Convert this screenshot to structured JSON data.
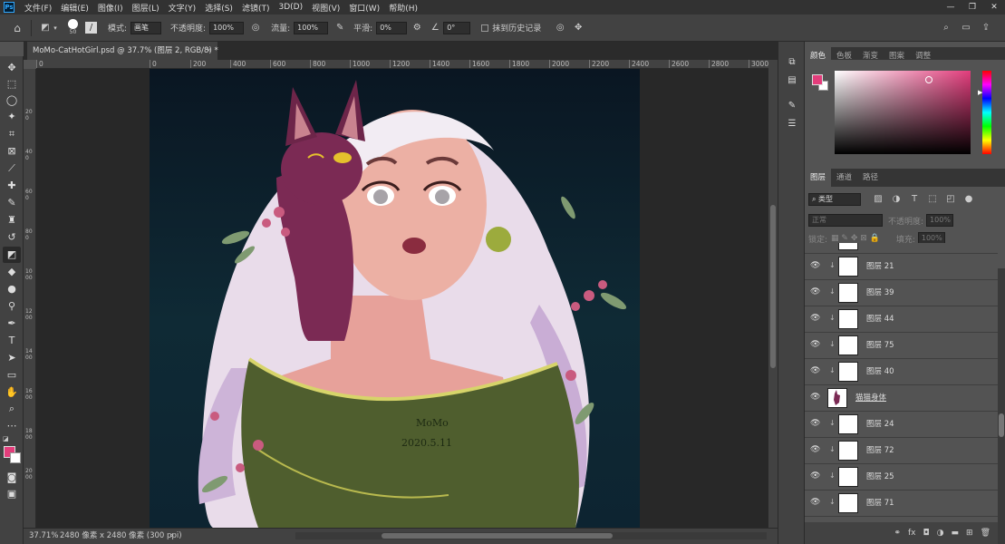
{
  "app": {
    "logo": "Ps"
  },
  "menu": [
    "文件(F)",
    "编辑(E)",
    "图像(I)",
    "图层(L)",
    "文字(Y)",
    "选择(S)",
    "滤镜(T)",
    "3D(D)",
    "视图(V)",
    "窗口(W)",
    "帮助(H)"
  ],
  "window_controls": [
    "—",
    "❐",
    "✕"
  ],
  "options": {
    "brush_size": "50",
    "mode_label": "模式:",
    "mode_value": "画笔",
    "opacity_label": "不透明度:",
    "opacity_value": "100%",
    "flow_label": "流量:",
    "flow_value": "100%",
    "smoothing_label": "平滑:",
    "smoothing_value": "0%",
    "angle_value": "0°",
    "erase_history_label": "抹到历史记录"
  },
  "document": {
    "tab_title": "MoMo-CatHotGirl.psd @ 37.7% (图层 2, RGB/8) *",
    "close": "×"
  },
  "ruler": {
    "h_ticks": [
      "0",
      "200",
      "400",
      "600",
      "800",
      "1000",
      "1200",
      "1400",
      "1600",
      "1800",
      "2000",
      "2200",
      "2400",
      "2600",
      "2800",
      "3000"
    ],
    "v_ticks": [
      "200",
      "400",
      "600",
      "800",
      "1000",
      "1200",
      "1400",
      "1600",
      "1800",
      "2000",
      "2200"
    ]
  },
  "artwork": {
    "signature_name": "MoMo",
    "signature_date": "2020.5.11"
  },
  "status": {
    "zoom": "37.71%",
    "doc_info": "2480 像素 x 2480 像素 (300 ppi)",
    "arrow": "›"
  },
  "color_panel": {
    "tabs": [
      "颜色",
      "色板",
      "渐变",
      "图案",
      "调整"
    ],
    "active_tab": 0,
    "foreground_color": "#e33d7b",
    "background_color": "#ffffff"
  },
  "layers_panel": {
    "tabs": [
      "图层",
      "通道",
      "路径"
    ],
    "filter_label": "类型",
    "blend_mode": "正常",
    "opacity_label": "不透明度:",
    "opacity_value": "100%",
    "lock_label": "锁定:",
    "fill_label": "填充:",
    "fill_value": "100%",
    "layers": [
      {
        "name": "图层 21",
        "clipped": true
      },
      {
        "name": "图层 39",
        "clipped": true
      },
      {
        "name": "图层 44",
        "clipped": true
      },
      {
        "name": "图层 75",
        "clipped": true
      },
      {
        "name": "图层 40",
        "clipped": true
      },
      {
        "name": "猫猫身体",
        "clipped": false
      },
      {
        "name": "图层 24",
        "clipped": true
      },
      {
        "name": "图层 72",
        "clipped": true
      },
      {
        "name": "图层 25",
        "clipped": true
      },
      {
        "name": "图层 71",
        "clipped": true
      }
    ]
  },
  "icons": {
    "eye": "👁",
    "clip_arrow": "↓"
  }
}
